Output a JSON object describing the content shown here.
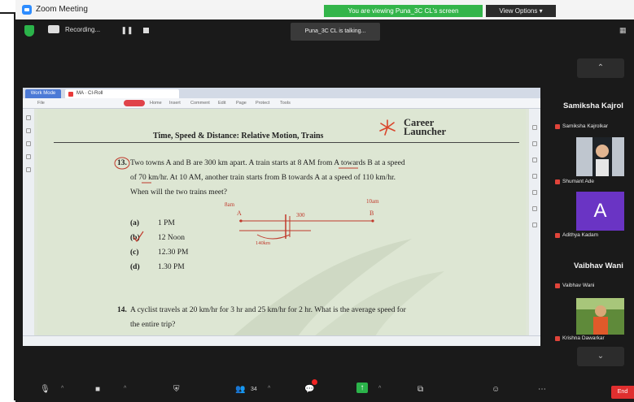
{
  "window": {
    "title": "Zoom Meeting"
  },
  "banner": {
    "sharing_text": "You are viewing Puna_3C CL's screen",
    "view_options": "View Options ▾"
  },
  "topbar": {
    "recording": "Recording...",
    "talking": "Puna_3C CL is talking..."
  },
  "shared": {
    "tabs": [
      "Work Mode",
      "MA · CI-Roll"
    ],
    "toolbar": [
      "File",
      "Home",
      "Insert",
      "Comment",
      "Edit",
      "Page",
      "Protect",
      "Tools"
    ],
    "doc_header": "Time, Speed & Distance: Relative Motion, Trains",
    "brand_line1": "Career",
    "brand_line2": "Launcher",
    "q13_num": "13.",
    "q13_line1": "Two towns A and B are 300 km apart. A train starts at 8 AM from A towards B at a speed",
    "q13_line2": "of 70 km/hr. At 10 AM, another train starts from B towards A at a speed of 110 km/hr.",
    "q13_line3": "When will the two trains meet?",
    "options": [
      {
        "key": "(a)",
        "value": "1 PM"
      },
      {
        "key": "(b)",
        "value": "12 Noon"
      },
      {
        "key": "(c)",
        "value": "12.30 PM"
      },
      {
        "key": "(d)",
        "value": "1.30 PM"
      }
    ],
    "annotations": {
      "a_time": "8am",
      "b_time": "10am",
      "a": "A",
      "b": "B",
      "mid": "300",
      "dist": "140km"
    },
    "q14_num": "14.",
    "q14_line1": "A cyclist travels at 20 km/hr for 3 hr and 25 km/hr for 2 hr. What is the average speed for",
    "q14_line2": "the entire trip?"
  },
  "participants": [
    {
      "name_big": "Samiksha  Kajrol",
      "label": "Samiksha Kajrolkar"
    },
    {
      "label": "Shumant Ade"
    },
    {
      "initial": "A",
      "label": "Adithya Kadam"
    },
    {
      "name_big": "Vaibhav  Wani",
      "label": "Vaibhav Wani"
    },
    {
      "label": "Krishna Dawarkar"
    }
  ],
  "bottom": {
    "participants_count": "34",
    "end": "End"
  }
}
